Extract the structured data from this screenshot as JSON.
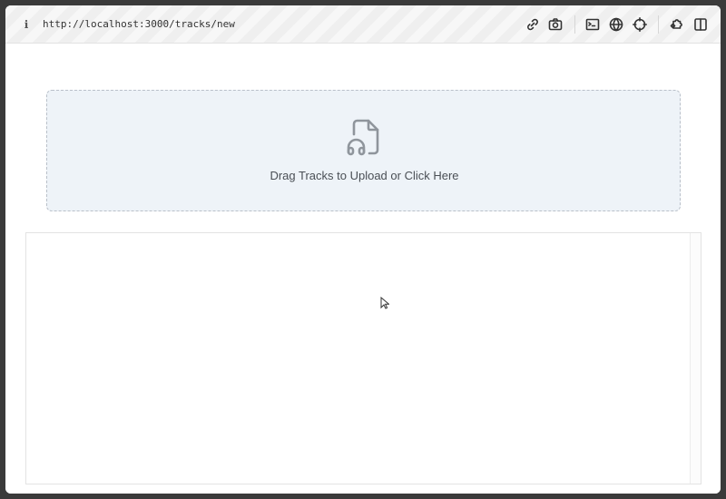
{
  "browser": {
    "url": "http://localhost:3000/tracks/new",
    "info_icon": "ℹ",
    "tools": [
      "link-icon",
      "camera-icon",
      "terminal-icon",
      "globe-icon",
      "crosshair-icon",
      "extension-icon",
      "split-view-icon"
    ]
  },
  "upload": {
    "label": "Drag Tracks to Upload or Click Here",
    "icon": "music-file-icon"
  },
  "colors": {
    "dropzone_bg": "#eef3f8",
    "dropzone_border": "#b9c0c9",
    "icon_gray": "#8f959c"
  }
}
